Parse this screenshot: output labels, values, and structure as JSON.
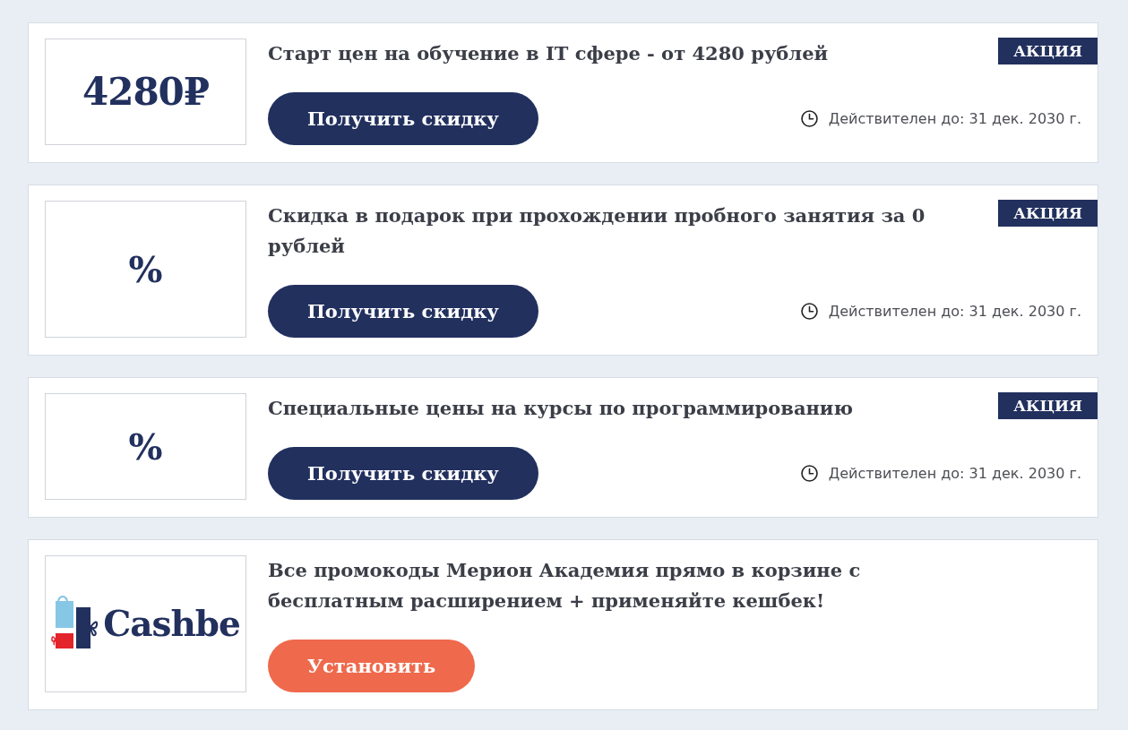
{
  "offers": [
    {
      "logo": {
        "kind": "text",
        "text": "4280₽"
      },
      "title": "Старт цен на обучение в IT сфере - от 4280 рублей",
      "badge": "АКЦИЯ",
      "button": {
        "kind": "primary",
        "label": "Получить скидку"
      },
      "validity": "Действителен до: 31 дек. 2030 г."
    },
    {
      "logo": {
        "kind": "text",
        "text": "%"
      },
      "title": "Скидка в подарок при прохождении пробного занятия за 0 рублей",
      "badge": "АКЦИЯ",
      "button": {
        "kind": "primary",
        "label": "Получить скидку"
      },
      "validity": "Действителен до: 31 дек. 2030 г."
    },
    {
      "logo": {
        "kind": "text",
        "text": "%"
      },
      "title": "Специальные цены на курсы по программированию",
      "badge": "АКЦИЯ",
      "button": {
        "kind": "primary",
        "label": "Получить скидку"
      },
      "validity": "Действителен до: 31 дек. 2030 г."
    },
    {
      "logo": {
        "kind": "brand",
        "text": "Cashbe"
      },
      "title": "Все промокоды Мерион Академия прямо в корзине с бесплатным расширением + применяйте кешбек!",
      "button": {
        "kind": "accent",
        "label": "Установить"
      }
    }
  ]
}
